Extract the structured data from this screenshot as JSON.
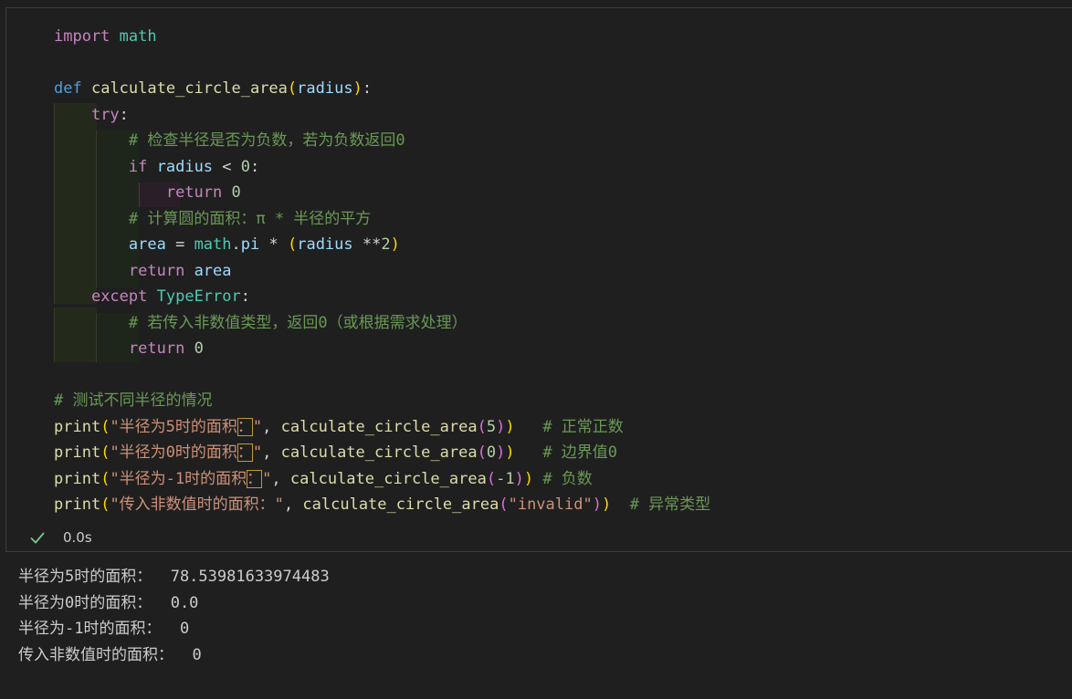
{
  "code": {
    "import_kw": "import",
    "import_mod": " math",
    "def_kw": "def",
    "func_name": "calculate_circle_area",
    "param": "radius",
    "try_kw": "try",
    "comment1": "# 检查半径是否为负数，若为负数返回0",
    "if_kw": "if",
    "radius_var": "radius",
    "lt_op": " < ",
    "zero": "0",
    "return_kw": "return",
    "comment2": "# 计算圆的面积：π * 半径的平方",
    "area_var": "area",
    "math_mod": "math",
    "pi_attr": "pi",
    "pow_op": " **",
    "two": "2",
    "except_kw": "except",
    "type_error": "TypeError",
    "comment3": "# 若传入非数值类型，返回0（或根据需求处理）",
    "comment4": "# 测试不同半径的情况",
    "print_fn": "print",
    "str1_a": "\"半径为5时的面积",
    "str1_ws": "：",
    "str1_b": "\"",
    "arg1": "5",
    "comment_p1": "# 正常正数",
    "str2_a": "\"半径为0时的面积",
    "str2_ws": "：",
    "str2_b": "\"",
    "arg2": "0",
    "comment_p2": "# 边界值0",
    "str3_a": "\"半径为-1时的面积",
    "str3_ws": "：",
    "str3_b": "\"",
    "arg3": "-1",
    "comment_p3": "# 负数",
    "str4": "\"传入非数值时的面积：\"",
    "arg4": "\"invalid\"",
    "comment_p4": "# 异常类型"
  },
  "status": {
    "icon": "check-icon",
    "exec_time": "0.0s"
  },
  "output": [
    "半径为5时的面积：  78.53981633974483",
    "半径为0时的面积：  0.0",
    "半径为-1时的面积：  0",
    "传入非数值时的面积：  0"
  ],
  "colors": {
    "background": "#1f1f1f",
    "keyword": "#c586c0",
    "function": "#dcdcaa",
    "string": "#ce9178",
    "comment": "#6a9955",
    "check": "#73c991"
  }
}
